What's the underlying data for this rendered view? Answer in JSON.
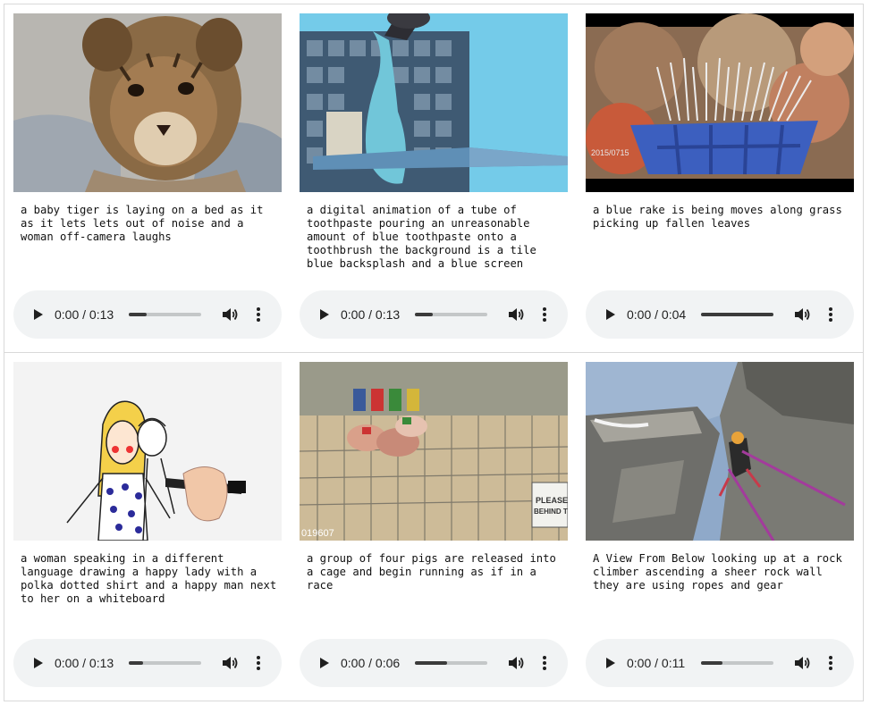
{
  "cards": [
    {
      "caption": "a baby tiger is laying on a bed as it as it lets lets out of noise and a woman off-camera laughs",
      "player": {
        "time": "0:00 / 0:13",
        "progress": 0.25
      }
    },
    {
      "caption": "a digital animation of a tube of toothpaste pouring an unreasonable amount of blue toothpaste onto a toothbrush the background is a tile blue backsplash and a blue screen",
      "player": {
        "time": "0:00 / 0:13",
        "progress": 0.25
      }
    },
    {
      "caption": "a blue rake is being moves along grass picking up fallen leaves",
      "player": {
        "time": "0:00 / 0:04",
        "progress": 1.0
      }
    },
    {
      "caption": "a woman speaking in a different language drawing a happy lady with a polka dotted shirt and a happy man next to her on a whiteboard",
      "player": {
        "time": "0:00 / 0:13",
        "progress": 0.2
      }
    },
    {
      "caption": "a group of four pigs are released into a cage and begin running as if in a race",
      "player": {
        "time": "0:00 / 0:06",
        "progress": 0.45
      }
    },
    {
      "caption": "A View From Below looking up at a rock climber ascending a sheer rock wall they are using ropes and gear",
      "player": {
        "time": "0:00 / 0:11",
        "progress": 0.3
      }
    }
  ],
  "thumb_overlays": {
    "rake_timestamp": "2015/0715",
    "pigs_timestamp": "019607",
    "pigs_sign": "PLEASE BEHIND T"
  },
  "icons": [
    "play-icon",
    "volume-icon",
    "more-vert-icon"
  ],
  "colors": {
    "player_bg": "#f1f3f4",
    "track": "#c4c7c8",
    "track_fill": "#3b3b3b",
    "border": "#d9d9d9"
  }
}
